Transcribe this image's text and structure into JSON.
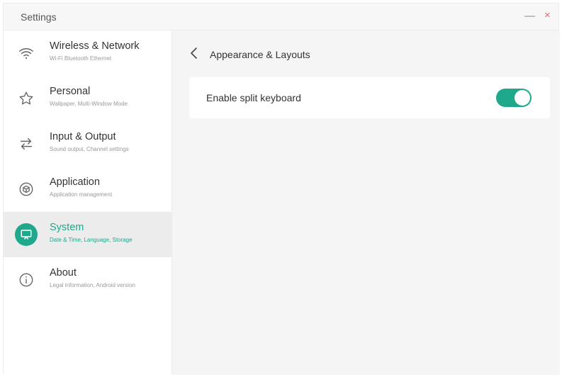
{
  "window": {
    "title": "Settings",
    "minimize_symbol": "—",
    "close_symbol": "×"
  },
  "sidebar": {
    "items": [
      {
        "label": "Wireless & Network",
        "subtitle": "Wi-Fi Bluetooth Ethernet",
        "icon": "wifi-icon",
        "active": false
      },
      {
        "label": "Personal",
        "subtitle": "Wallpaper, Multi-Window Mode",
        "icon": "star-icon",
        "active": false
      },
      {
        "label": "Input & Output",
        "subtitle": "Sound output, Channel settings",
        "icon": "swap-arrows-icon",
        "active": false
      },
      {
        "label": "Application",
        "subtitle": "Application management",
        "icon": "cube-icon",
        "active": false
      },
      {
        "label": "System",
        "subtitle": "Date & Time, Language, Storage",
        "icon": "display-icon",
        "active": true
      },
      {
        "label": "About",
        "subtitle": "Legal information, Android version",
        "icon": "info-icon",
        "active": false
      }
    ]
  },
  "main": {
    "title": "Appearance & Layouts",
    "settings": [
      {
        "label": "Enable split keyboard",
        "enabled": true
      }
    ]
  },
  "colors": {
    "accent": "#1fa88c",
    "close": "#e36a6a"
  }
}
